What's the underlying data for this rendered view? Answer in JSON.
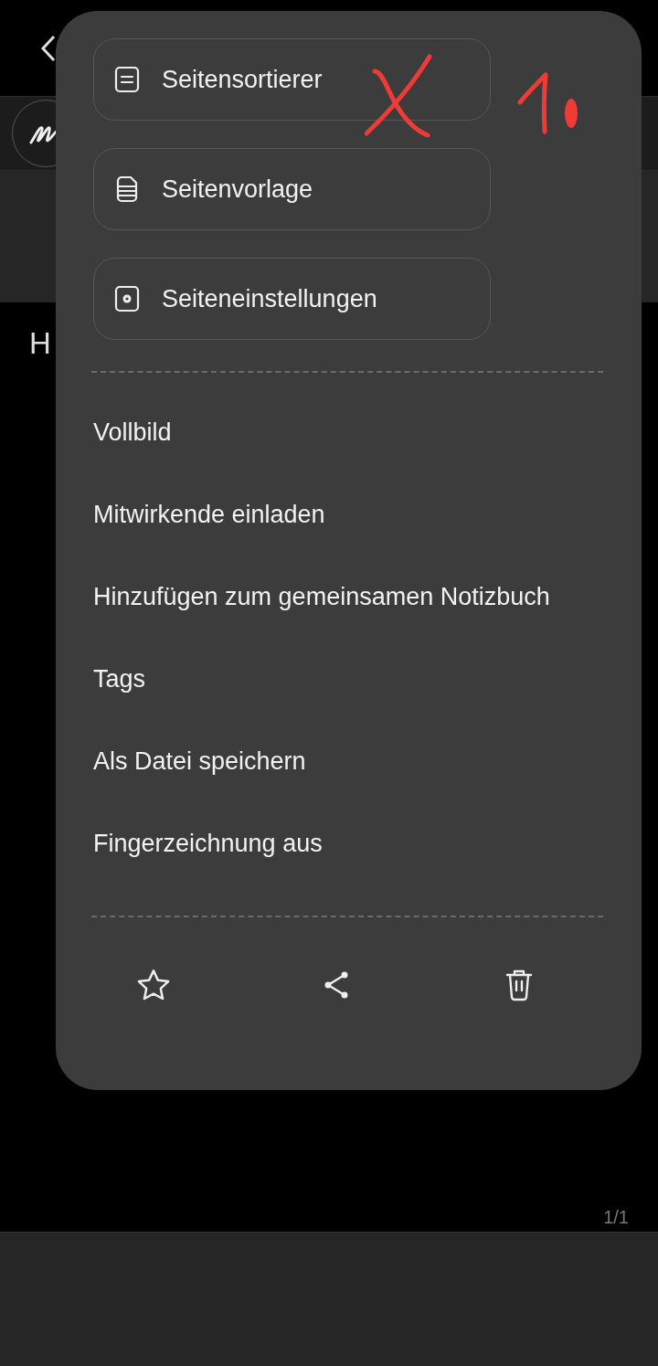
{
  "background": {
    "note_text": "H",
    "page_indicator": "1/1"
  },
  "menu": {
    "page_buttons": [
      {
        "label": "Seitensortierer",
        "kind": "page"
      },
      {
        "label": "Seitenvorlage",
        "kind": "template"
      },
      {
        "label": "Seiteneinstellungen",
        "kind": "settings"
      }
    ],
    "items": [
      "Vollbild",
      "Mitwirkende einladen",
      "Hinzufügen zum gemeinsamen Notizbuch",
      "Tags",
      "Als Datei speichern",
      "Fingerzeichnung aus"
    ],
    "actions": [
      {
        "kind": "favorite"
      },
      {
        "kind": "share"
      },
      {
        "kind": "delete"
      }
    ]
  }
}
